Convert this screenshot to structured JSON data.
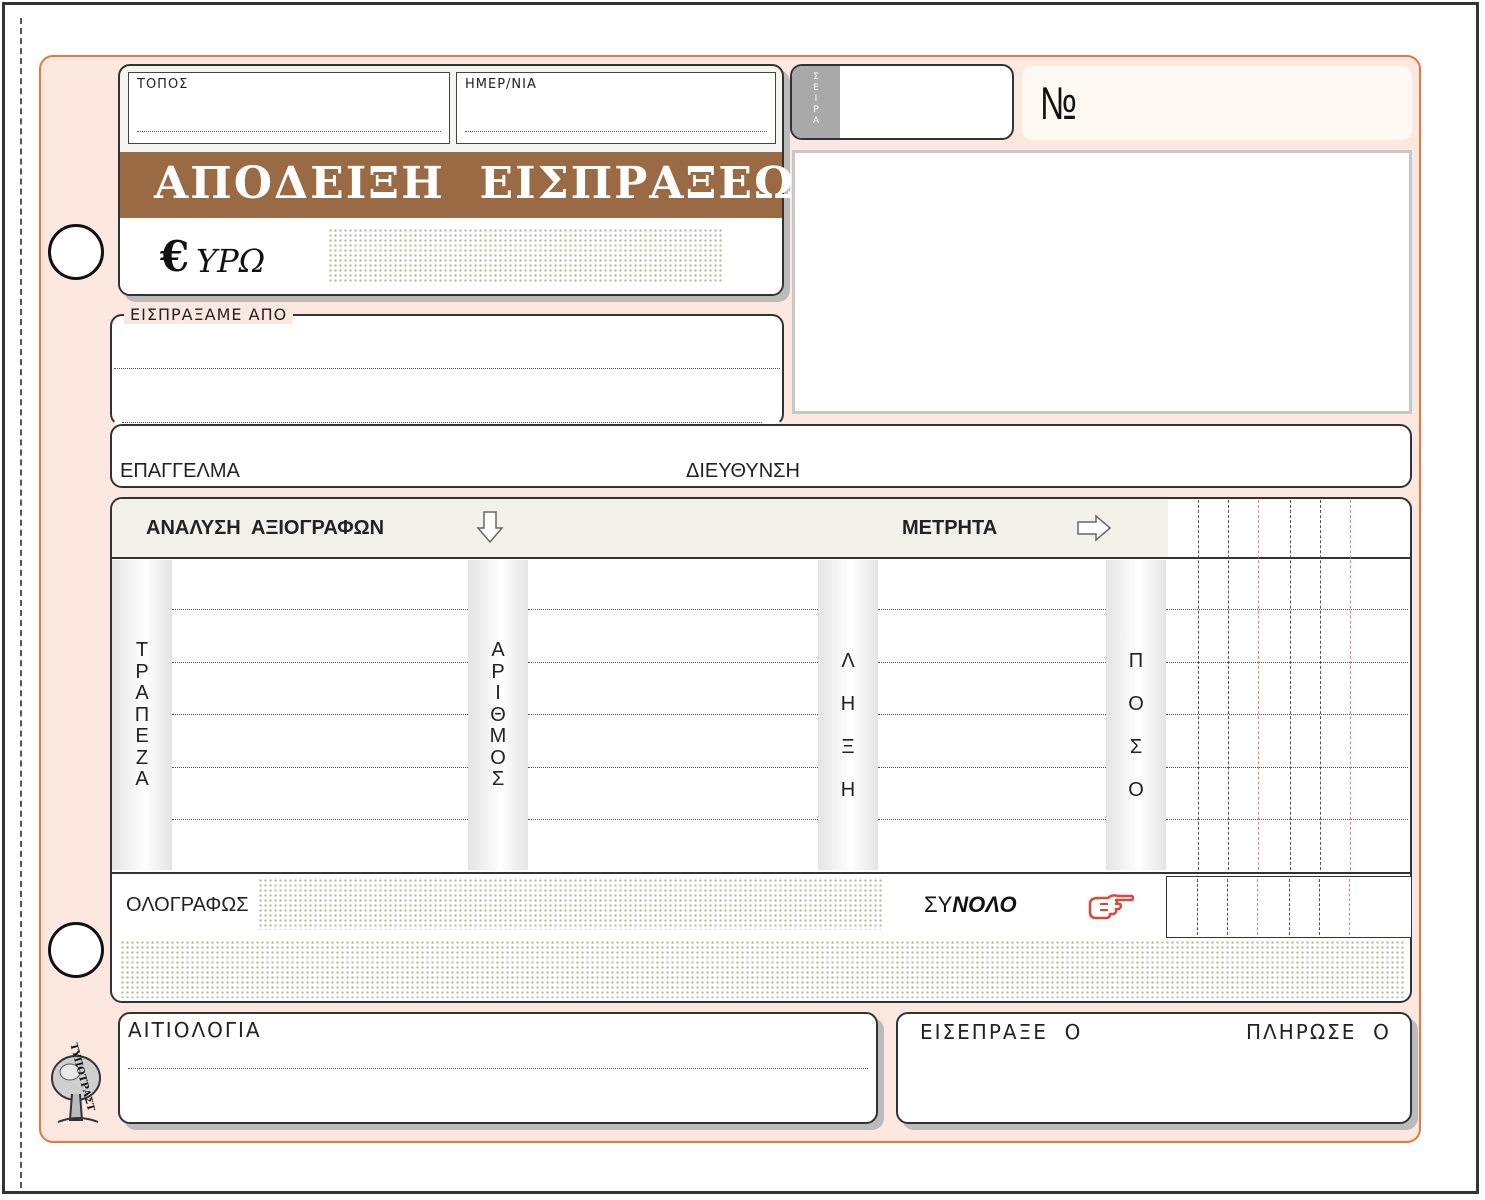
{
  "header": {
    "place_label": "ΤΟΠΟΣ",
    "date_label": "ΗΜΕΡ/ΝΙΑ",
    "title": "ΑΠΟΔΕΙΞΗ  ΕΙΣΠΡΑΞΕΩΣ",
    "currency_symbol": "€",
    "currency_rest": "ΥΡΩ",
    "series_label": "ΣΕΙΡΑ",
    "number_label": "№"
  },
  "payer": {
    "received_from_label": "ΕΙΣΠΡΑΞΑΜΕ  ΑΠΟ",
    "profession_label": "ΕΠΑΓΓΕΛΜΑ",
    "address_label": "ΔΙΕΥΘΥΝΣΗ"
  },
  "payments": {
    "securities_label": "ΑΝΑΛΥΣΗ  ΑΞΙΟΓΡΑΦΩΝ",
    "cash_label": "ΜΕΤΡΗΤΑ",
    "columns": [
      "ΤΡΑΠΕΖΑ",
      "ΑΡΙΘΜΟΣ",
      "ΛΗΞΗ",
      "ΠΟΣΟ"
    ],
    "in_words_label": "ΟΛΟΓΡΑΦΩΣ",
    "total_prefix": "ΣΥ",
    "total_suffix": "ΝΟΛΟ"
  },
  "footer": {
    "reason_label": "ΑΙΤΙΟΛΟΓΙΑ",
    "collected_by_label": "ΕΙΣΕΠΡΑΞΕ  Ο",
    "paid_by_label": "ΠΛΗΡΩΣΕ  Ο",
    "logo_text": "ΤΥΠΟΤΡΑΣΤ"
  },
  "colors": {
    "sheet_bg": "#fde8df",
    "sheet_border": "#e07a3e",
    "title_band": "#9a6a45",
    "hand_icon": "#d9483a"
  }
}
